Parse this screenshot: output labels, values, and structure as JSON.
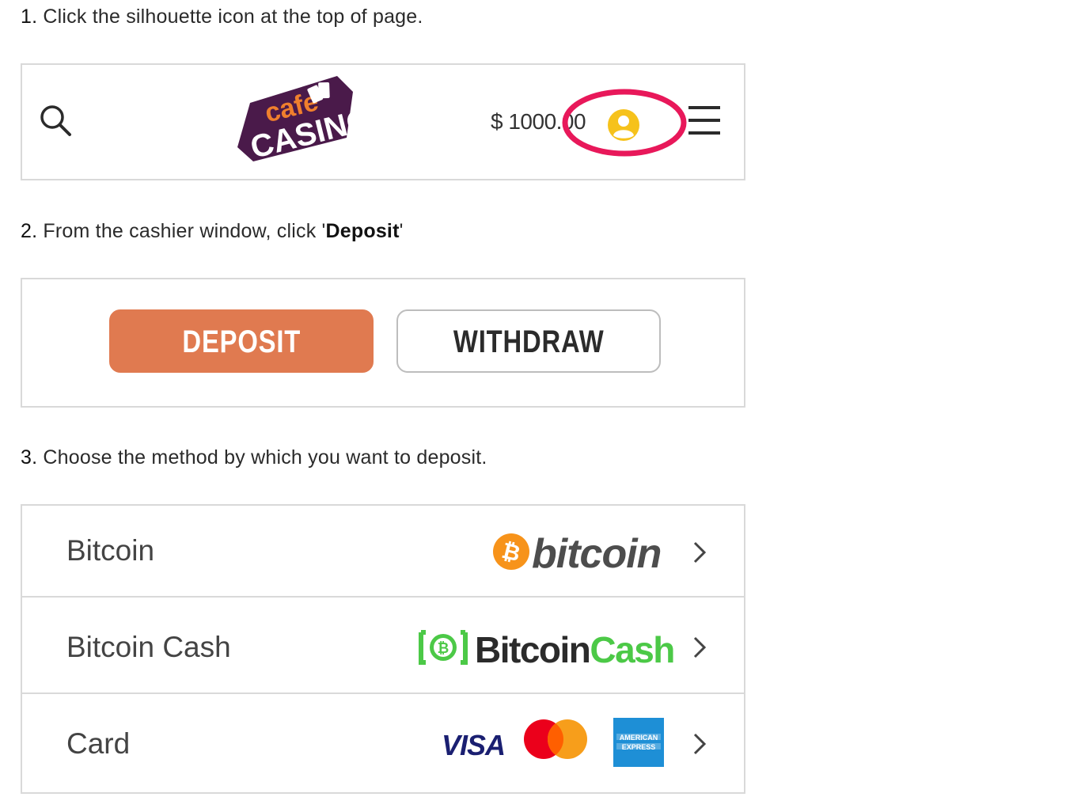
{
  "steps": [
    {
      "num": "1.",
      "text": "Click the silhouette icon at the top of page."
    },
    {
      "num": "2.",
      "text_before": "From the cashier window, click '",
      "bold": "Deposit",
      "text_after": "'"
    },
    {
      "num": "3.",
      "text": "Choose the method by which you want to deposit."
    }
  ],
  "header": {
    "logo_top": "cafe",
    "logo_bottom": "CASINO",
    "balance": "$ 1000.00"
  },
  "cashier": {
    "deposit_label": "DEPOSIT",
    "withdraw_label": "WITHDRAW"
  },
  "methods": [
    {
      "label": "Bitcoin",
      "brand_text": "bitcoin",
      "brand_symbol": "₿"
    },
    {
      "label": "Bitcoin Cash",
      "brand_text_1": "Bitcoin",
      "brand_text_2": "Cash",
      "brand_symbol": "₿"
    },
    {
      "label": "Card",
      "visa": "VISA",
      "amex_line1": "AMERICAN",
      "amex_line2": "EXPRESS"
    }
  ],
  "colors": {
    "accent_orange": "#e07a50",
    "highlight_ring": "#e8185a",
    "user_icon": "#f6c21b",
    "bitcoin_orange": "#f7931a",
    "bitcoin_cash_green": "#4cc947",
    "visa_blue": "#1a1f71",
    "amex_blue": "#1e8fd6",
    "logo_purple": "#4a1a4a",
    "logo_orange": "#ef7f2d"
  },
  "icons": [
    "search-icon",
    "user-icon",
    "menu-icon",
    "chevron-right-icon",
    "bitcoin-icon",
    "bitcoin-cash-icon",
    "mastercard-icon",
    "amex-icon"
  ]
}
